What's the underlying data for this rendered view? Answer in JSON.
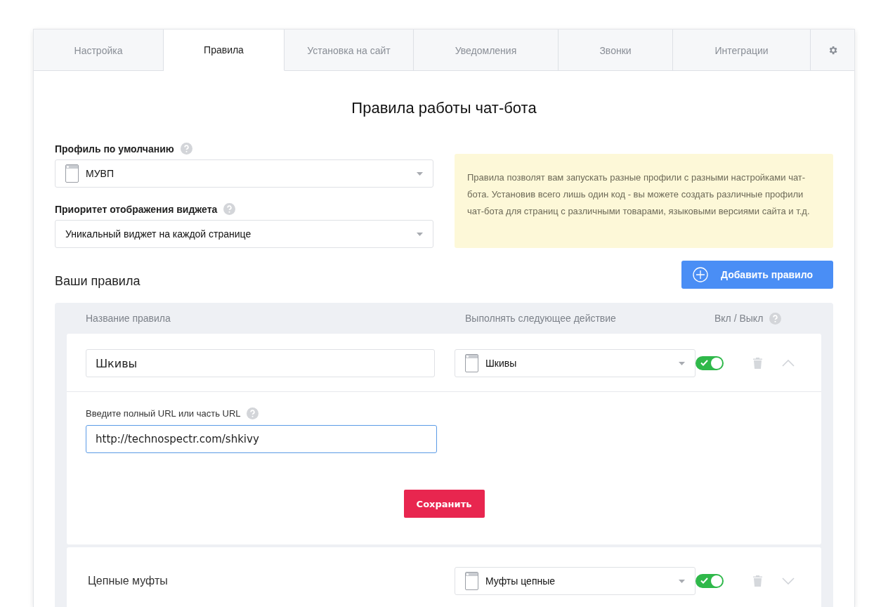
{
  "tabs": [
    {
      "label": "Настройка",
      "selected": false
    },
    {
      "label": "Правила",
      "selected": true
    },
    {
      "label": "Установка на сайт",
      "selected": false
    },
    {
      "label": "Уведомления",
      "selected": false
    },
    {
      "label": "Звонки",
      "selected": false
    },
    {
      "label": "Интеграции",
      "selected": false
    }
  ],
  "title": "Правила работы чат-бота",
  "default_profile": {
    "label": "Профиль по умолчанию",
    "value": "МУВП"
  },
  "widget_priority": {
    "label": "Приоритет отображения виджета",
    "value": "Уникальный виджет на каждой странице"
  },
  "info_text": "Правила позволят вам запускать разные профили с разными настройками чат-бота. Установив всего лишь один код - вы можете создать различные профили чат-бота для страниц с различными товарами, языковыми версиями сайта и т.д.",
  "rules_heading": "Ваши правила",
  "add_button": "Добавить правило",
  "columns": [
    "Название правила",
    "Выполнять следующее действие",
    "Вкл / Выкл"
  ],
  "rules": [
    {
      "name": "Шкивы",
      "action": "Шкивы",
      "enabled": true,
      "expanded": true,
      "url_label": "Введите полный URL или часть URL",
      "url": "http://technospectr.com/shkivy",
      "save": "Сохранить"
    },
    {
      "name": "Цепные муфты",
      "action": "Муфты цепные",
      "enabled": true,
      "expanded": false
    }
  ]
}
